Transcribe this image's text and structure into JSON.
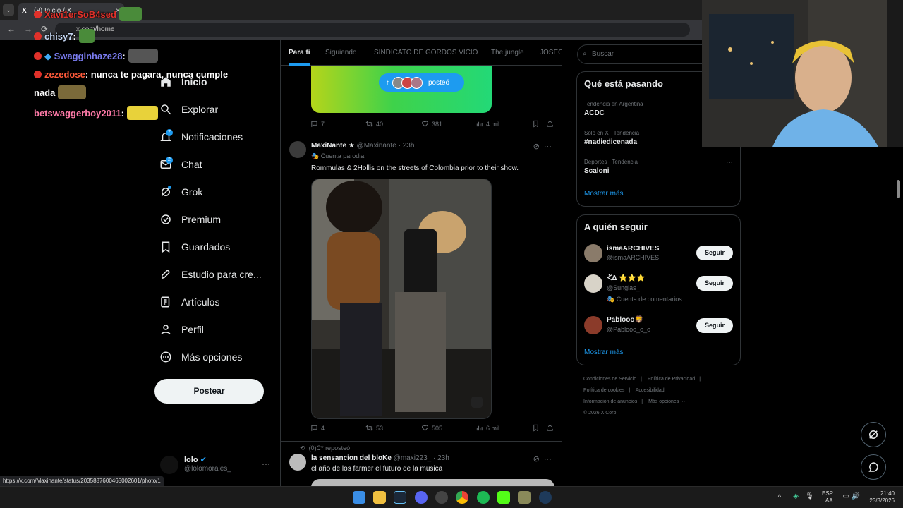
{
  "browser": {
    "tab_title": "(8) Inicio / X",
    "url": "x.com/home",
    "status_link": "https://x.com/Maxinante/status/2035887600465002601/photo/1"
  },
  "stream_chat": [
    {
      "user": "Xavi1erSoB4sed",
      "message": "",
      "user_color": "#e0312a"
    },
    {
      "user": "chisy7",
      "message": ":",
      "user_color": "#c7d8f5"
    },
    {
      "user": "Swagginhaze28",
      "message": ":",
      "user_color": "#7a7cf0"
    },
    {
      "user": "zezedose",
      "message": ": nunca te pagara, nunca cumple",
      "message2": "nada",
      "user_color": "#ff5a3a"
    },
    {
      "user": "betswaggerboy2011",
      "message": ":",
      "user_color": "#ff7aa8"
    }
  ],
  "nav": {
    "items": [
      {
        "label": "Inicio",
        "icon": "home-icon"
      },
      {
        "label": "Explorar",
        "icon": "search-icon"
      },
      {
        "label": "Notificaciones",
        "icon": "bell-icon",
        "badge": "7"
      },
      {
        "label": "Chat",
        "icon": "mail-icon",
        "badge": "2"
      },
      {
        "label": "Grok",
        "icon": "grok-icon"
      },
      {
        "label": "Premium",
        "icon": "premium-icon"
      },
      {
        "label": "Guardados",
        "icon": "bookmark-icon"
      },
      {
        "label": "Estudio para cre...",
        "icon": "rocket-icon"
      },
      {
        "label": "Artículos",
        "icon": "article-icon"
      },
      {
        "label": "Perfil",
        "icon": "person-icon"
      },
      {
        "label": "Más opciones",
        "icon": "more-circle-icon"
      }
    ],
    "post_button": "Postear",
    "account": {
      "name": "lolo",
      "handle": "@lolomorales_"
    }
  },
  "timeline": {
    "tabs": [
      "Para ti",
      "Siguiendo",
      "SINDICATO DE GORDOS VICIO",
      "The jungle",
      "JOSEO"
    ],
    "new_posts_pill": "posteó",
    "post1": {
      "replies": "7",
      "reposts": "40",
      "likes": "381",
      "views": "4 mil"
    },
    "post2": {
      "name": "MaxiNante",
      "handle": "@Maxinante",
      "time": "· 23h",
      "parody": "Cuenta parodia",
      "text": "Rommulas & 2Hollis on the streets of Colombia prior to their show.",
      "replies": "4",
      "reposts": "53",
      "likes": "505",
      "views": "6 mil"
    },
    "post3": {
      "repost_by": "(0)C* reposteó",
      "name": "la sensancion del bloKe",
      "handle": "@maxi223_",
      "time": "· 23h",
      "text": "el año de los farmer el futuro de la musica"
    }
  },
  "sidebar": {
    "search_placeholder": "Buscar",
    "trends_title": "Qué está pasando",
    "trends": [
      {
        "meta": "Tendencia en Argentina",
        "name": "ACDC"
      },
      {
        "meta": "Solo en X · Tendencia",
        "name": "#nadiedicenada"
      },
      {
        "meta": "Deportes · Tendencia",
        "name": "Scaloni"
      }
    ],
    "show_more": "Mostrar más",
    "follow_title": "A quién seguir",
    "follow": [
      {
        "name": "ismaARCHIVES",
        "handle": "@ismaARCHIVES",
        "button": "Seguir"
      },
      {
        "name": "ᢵΔ ⭐⭐⭐",
        "handle": "@Sunglas_",
        "sub": "Cuenta de comentarios",
        "button": "Seguir"
      },
      {
        "name": "Pablooo🦁",
        "handle": "@Pablooo_o_o",
        "button": "Seguir"
      }
    ],
    "follow_more": "Mostrar más",
    "footer": [
      "Condiciones de Servicio",
      "Política de Privacidad",
      "Política de cookies",
      "Accesibilidad",
      "Información de anuncios",
      "Más opciones ···",
      "© 2026 X Corp."
    ]
  },
  "taskbar": {
    "lang_line1": "ESP",
    "lang_line2": "LAA",
    "time": "21:40",
    "date": "23/3/2026"
  },
  "colors": {
    "accent": "#1d9bf0",
    "background": "#000000",
    "border": "#2f3336",
    "muted": "#71767b"
  }
}
